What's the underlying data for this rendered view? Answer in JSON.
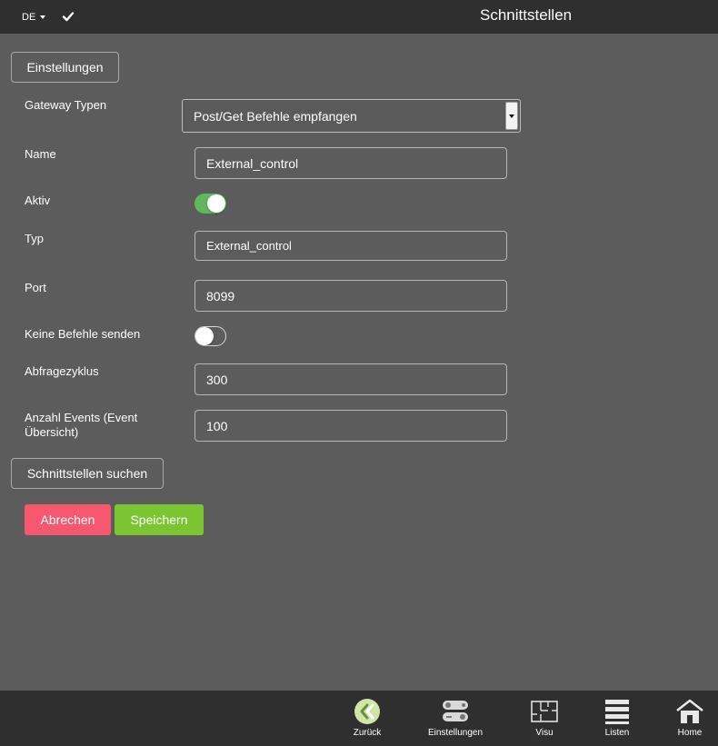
{
  "header": {
    "language": "DE",
    "title": "Schnittstellen"
  },
  "section_button": "Einstellungen",
  "form": {
    "gateway_label": "Gateway Typen",
    "gateway_value": "Post/Get Befehle empfangen",
    "name_label": "Name",
    "name_value": "External_control",
    "aktiv_label": "Aktiv",
    "aktiv_on": true,
    "typ_label": "Typ",
    "typ_value": "External_control",
    "port_label": "Port",
    "port_value": "8099",
    "keine_label": "Keine Befehle senden",
    "keine_on": false,
    "abfrage_label": "Abfragezyklus",
    "abfrage_value": "300",
    "anzahl_label_line1": "Anzahl Events (Event",
    "anzahl_label_line2": "Übersicht)",
    "anzahl_value": "100"
  },
  "search_button": "Schnittstellen suchen",
  "actions": {
    "cancel": "Abrechen",
    "save": "Speichern",
    "cancel_color": "#f5586f",
    "save_color": "#7cc532"
  },
  "bottom_nav": {
    "back": "Zurück",
    "settings": "Einstellungen",
    "visu": "Visu",
    "lists": "Listen",
    "home": "Home"
  }
}
